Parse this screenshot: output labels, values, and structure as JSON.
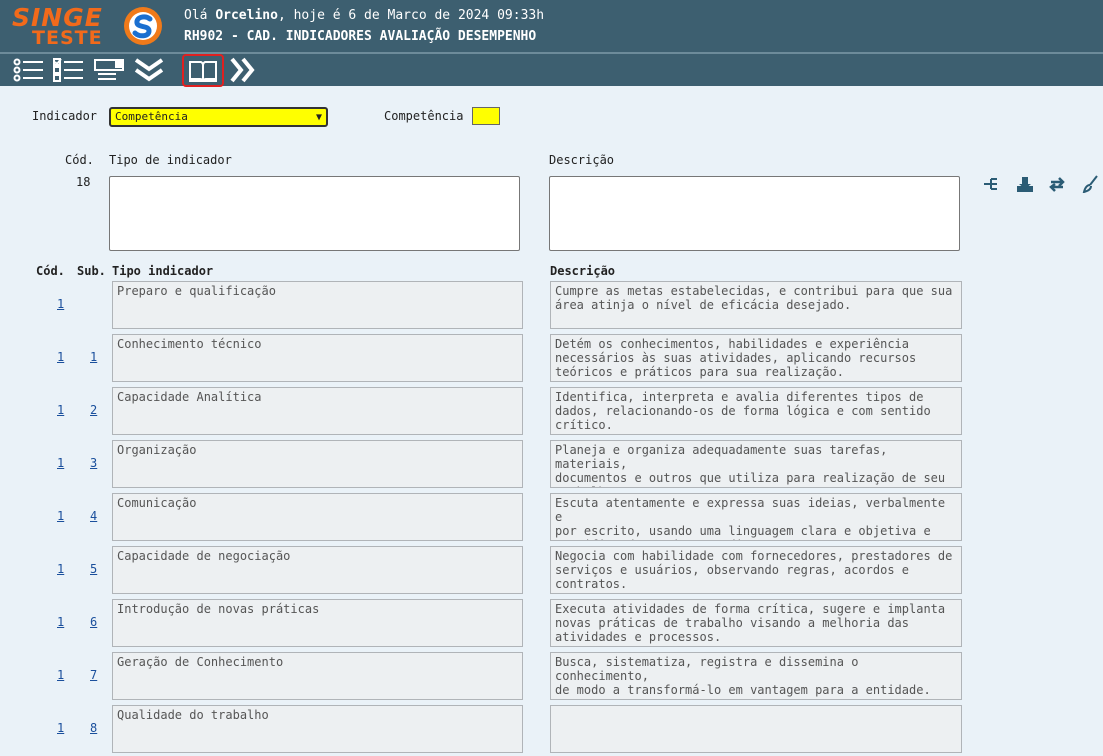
{
  "header": {
    "logo_top": "SINGE",
    "logo_bottom": "TESTE",
    "greeting_prefix": "Olá ",
    "user": "Orcelino",
    "greeting_suffix": ", hoje é 6 de Marco de 2024 09:33h",
    "title": "RH902 - CAD. INDICADORES AVALIAÇÃO DESEMPENHO"
  },
  "toolbar": {
    "icons": [
      "list-icon",
      "checklist-icon",
      "form-icon",
      "double-chevron-down-icon",
      "book-icon",
      "double-chevron-right-icon"
    ]
  },
  "filter": {
    "indicador_label": "Indicador",
    "indicador_value": "Competência",
    "competencia_label": "Competência",
    "competencia_color": "#ffff00"
  },
  "form": {
    "cod_label": "Cód.",
    "cod_value": "18",
    "tipo_label": "Tipo de indicador",
    "descricao_label": "Descrição",
    "tipo_value": "",
    "descricao_value": ""
  },
  "table": {
    "headers": {
      "cod": "Cód.",
      "sub": "Sub.",
      "tipo": "Tipo indicador",
      "descricao": "Descrição"
    },
    "rows": [
      {
        "cod": "1",
        "sub": "",
        "tipo": "Preparo e qualificação",
        "descricao": "Cumpre as metas estabelecidas, e contribui para que sua\nárea atinja o nível de eficácia desejado."
      },
      {
        "cod": "1",
        "sub": "1",
        "tipo": "Conhecimento técnico",
        "descricao": "Detém os conhecimentos, habilidades e experiência\nnecessários às suas atividades, aplicando recursos\nteóricos e práticos para sua realização."
      },
      {
        "cod": "1",
        "sub": "2",
        "tipo": "Capacidade Analítica",
        "descricao": "Identifica, interpreta e avalia diferentes tipos de\ndados, relacionando-os de forma lógica e com sentido\ncrítico."
      },
      {
        "cod": "1",
        "sub": "3",
        "tipo": "Organização",
        "descricao": "Planeja e organiza adequadamente suas tarefas, materiais,\ndocumentos e outros que utiliza para realização de seu\ntrabalho."
      },
      {
        "cod": "1",
        "sub": "4",
        "tipo": "Comunicação",
        "descricao": "Escuta atentamente e expressa suas ideias, verbalmente e\npor escrito, usando uma linguagem clara e objetiva e\ncertificando-se do entendimento."
      },
      {
        "cod": "1",
        "sub": "5",
        "tipo": "Capacidade de negociação",
        "descricao": "Negocia com habilidade com fornecedores, prestadores de\nserviços e usuários, observando regras, acordos e\ncontratos."
      },
      {
        "cod": "1",
        "sub": "6",
        "tipo": "Introdução de novas práticas",
        "descricao": "Executa atividades de forma crítica, sugere e implanta\nnovas práticas de trabalho visando a melhoria das\natividades e processos."
      },
      {
        "cod": "1",
        "sub": "7",
        "tipo": "Geração de Conhecimento",
        "descricao": "Busca, sistematiza, registra e dissemina o conhecimento,\nde modo a transformá-lo em vantagem para a entidade."
      },
      {
        "cod": "1",
        "sub": "8",
        "tipo": "Qualidade do trabalho",
        "descricao": ""
      }
    ]
  },
  "actions": [
    "tree-icon",
    "save-icon",
    "swap-icon",
    "brush-icon"
  ]
}
